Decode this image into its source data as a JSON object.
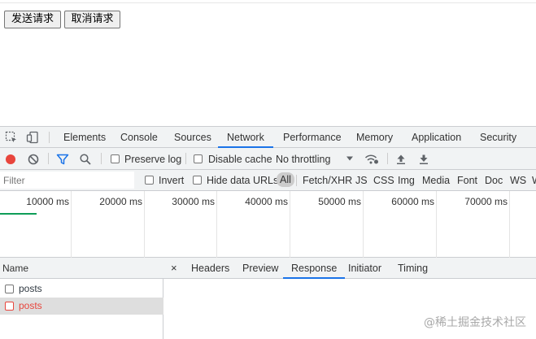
{
  "page": {
    "send_button": "发送请求",
    "cancel_button": "取消请求"
  },
  "devtools": {
    "tabs": [
      "Elements",
      "Console",
      "Sources",
      "Network",
      "Performance",
      "Memory",
      "Application",
      "Security"
    ],
    "active_tab": "Network",
    "toolbar": {
      "preserve_log": "Preserve log",
      "disable_cache": "Disable cache",
      "throttling": "No throttling"
    },
    "filter": {
      "placeholder": "Filter",
      "invert": "Invert",
      "hide_data_urls": "Hide data URLs",
      "types": [
        "All",
        "Fetch/XHR",
        "JS",
        "CSS",
        "Img",
        "Media",
        "Font",
        "Doc",
        "WS",
        "W"
      ]
    },
    "timeline": {
      "ticks": [
        "10000 ms",
        "20000 ms",
        "30000 ms",
        "40000 ms",
        "50000 ms",
        "60000 ms",
        "70000 ms"
      ]
    },
    "requests": {
      "header": "Name",
      "items": [
        {
          "name": "posts",
          "selected": false
        },
        {
          "name": "posts",
          "selected": true
        }
      ]
    },
    "detail": {
      "close": "×",
      "tabs": [
        "Headers",
        "Preview",
        "Response",
        "Initiator",
        "Timing"
      ],
      "active_tab": "Response"
    }
  },
  "watermark": "@稀土掘金技术社区",
  "colors": {
    "accent": "#1a73e8",
    "record_red": "#e8453c",
    "timeline_green": "#0f9d58",
    "filter_blue": "#1a73e8"
  }
}
